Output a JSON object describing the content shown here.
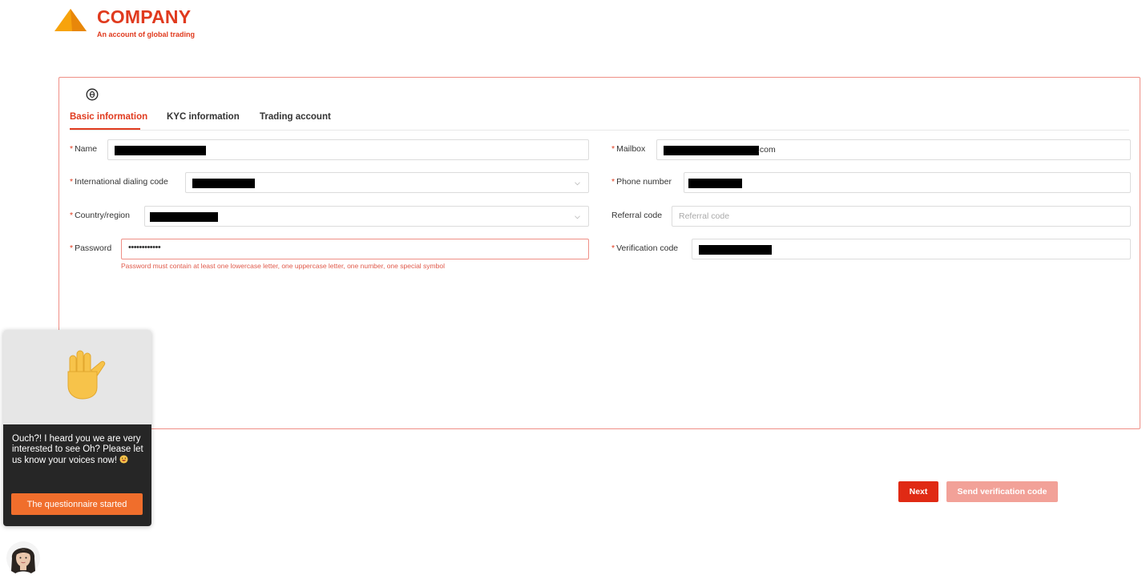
{
  "brand": {
    "name": "COMPANY",
    "tagline": "An account of global trading",
    "color": "#e03a1e"
  },
  "icons": [
    "logo-icon",
    "globe-icon",
    "chevron-down-icon",
    "raised-hand-icon",
    "smile-emoji-icon",
    "avatar"
  ],
  "tabs": [
    {
      "label": "Basic information",
      "active": true
    },
    {
      "label": "KYC information",
      "active": false
    },
    {
      "label": "Trading account",
      "active": false
    }
  ],
  "form": {
    "name": {
      "label": "Name",
      "required": true,
      "value_redacted": true
    },
    "mailbox": {
      "label": "Mailbox",
      "required": true,
      "value_suffix": ".com"
    },
    "dialing_code": {
      "label": "International dialing code",
      "required": true,
      "value_redacted": true
    },
    "phone": {
      "label": "Phone number",
      "required": true,
      "value_redacted": true
    },
    "country": {
      "label": "Country/region",
      "required": true,
      "value_redacted": true
    },
    "referral": {
      "label": "Referral code",
      "required": false,
      "placeholder": "Referral code"
    },
    "password": {
      "label": "Password",
      "required": true,
      "value": "••••••••••••",
      "hint": "Password must contain at least one lowercase letter, one uppercase letter, one number, one special symbol"
    },
    "verification": {
      "label": "Verification code",
      "required": true,
      "value_redacted": true
    }
  },
  "actions": {
    "next_label": "Next",
    "send_code_label": "Send verification code"
  },
  "survey": {
    "message": "Ouch?! I heard you we are very interested to see Oh? Please let us know your voices now!",
    "button_label": "The questionnaire started"
  }
}
